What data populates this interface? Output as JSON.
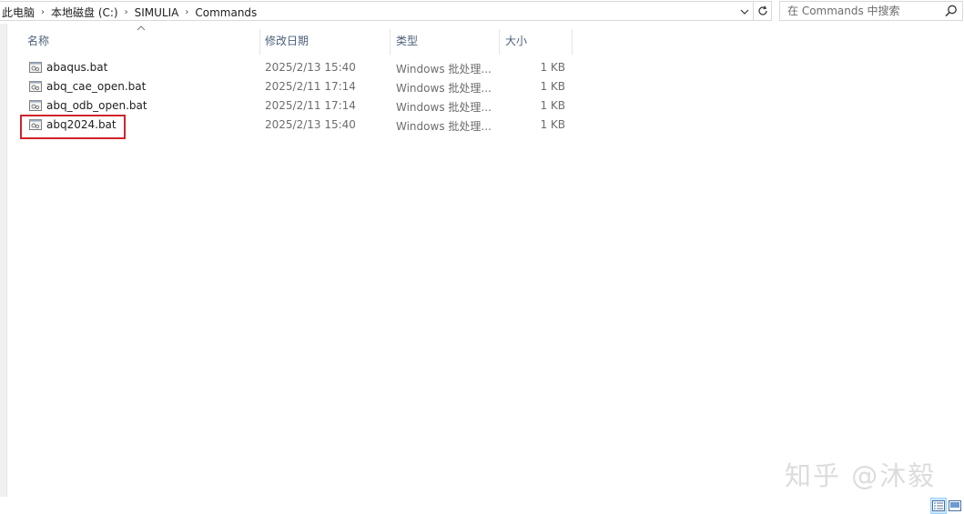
{
  "address_bar": {
    "crumbs": [
      "此电脑",
      "本地磁盘 (C:)",
      "SIMULIA",
      "Commands"
    ]
  },
  "search": {
    "placeholder": "在 Commands 中搜索"
  },
  "columns": {
    "name": "名称",
    "modified": "修改日期",
    "type": "类型",
    "size": "大小"
  },
  "files": [
    {
      "name": "abaqus.bat",
      "modified": "2025/2/13 15:40",
      "type": "Windows 批处理...",
      "size": "1 KB"
    },
    {
      "name": "abq_cae_open.bat",
      "modified": "2025/2/11 17:14",
      "type": "Windows 批处理...",
      "size": "1 KB"
    },
    {
      "name": "abq_odb_open.bat",
      "modified": "2025/2/11 17:14",
      "type": "Windows 批处理...",
      "size": "1 KB"
    },
    {
      "name": "abq2024.bat",
      "modified": "2025/2/13 15:40",
      "type": "Windows 批处理...",
      "size": "1 KB"
    }
  ],
  "watermark": "知乎 @沐毅",
  "colors": {
    "highlight_border": "#d2232a",
    "header_text": "#4c607a",
    "selected_view": "#cce8ff"
  }
}
